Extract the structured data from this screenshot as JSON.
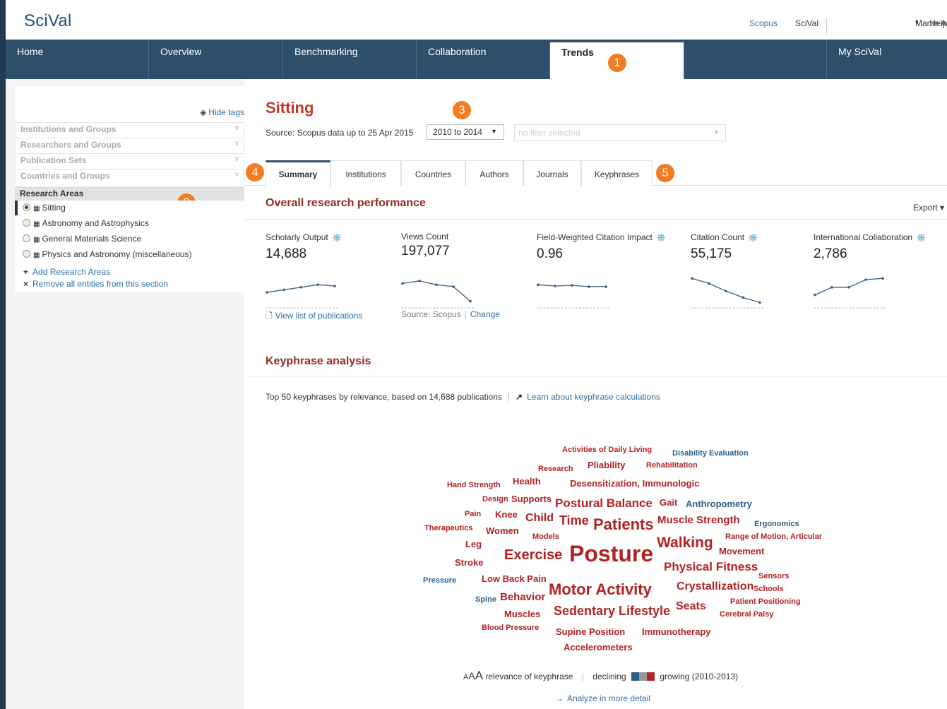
{
  "app": {
    "logo": "SciVal"
  },
  "toplinks": {
    "scopus": "Scopus",
    "scival": "SciVal",
    "user": "Martin Andersson",
    "user_caret": "▾",
    "help": "Help"
  },
  "nav": {
    "items": [
      "Home",
      "Overview",
      "Benchmarking",
      "Collaboration",
      "Trends",
      "",
      "My SciVal"
    ],
    "active": "Trends"
  },
  "badges": {
    "b1": "1",
    "b2": "2",
    "b3": "3",
    "b4": "4",
    "b5": "5"
  },
  "sidebar": {
    "hide_tags": "Hide tags",
    "sections": [
      "Institutions and Groups",
      "Researchers and Groups",
      "Publication Sets",
      "Countries and Groups"
    ],
    "research_areas_title": "Research Areas",
    "research_areas": [
      "Sitting",
      "Astronomy and Astrophysics",
      "General Materials Science",
      "Physics and Astronomy (miscellaneous)"
    ],
    "add_link": "Add Research Areas",
    "remove_link": "Remove all entities from this section"
  },
  "main": {
    "title": "Sitting",
    "source": "Source: Scopus data up to 25 Apr 2015",
    "year_range": "2010 to 2014",
    "filter_placeholder": "no filter selected",
    "tabs": [
      "Summary",
      "Institutions",
      "Countries",
      "Authors",
      "Journals",
      "Keyphrases"
    ],
    "active_tab": "Summary",
    "overall_title": "Overall research performance",
    "export": "Export",
    "metrics": [
      {
        "label": "Scholarly Output",
        "value": "14,688",
        "gear": true,
        "trend": [
          2,
          2.4,
          2.8,
          3.2,
          3
        ]
      },
      {
        "label": "Views Count",
        "value": "197,077",
        "gear": false,
        "trend": [
          3.4,
          3.8,
          3.2,
          2.9,
          0.6
        ]
      },
      {
        "label": "Field-Weighted Citation Impact",
        "value": "0.96",
        "gear": true,
        "trend": [
          3.2,
          3,
          3.1,
          2.9,
          2.9
        ]
      },
      {
        "label": "Citation Count",
        "value": "55,175",
        "gear": true,
        "trend": [
          4.2,
          3.4,
          2.2,
          1.2,
          0.4
        ]
      },
      {
        "label": "International Collaboration",
        "value": "2,786",
        "gear": true,
        "trend": [
          1.6,
          2.8,
          2.8,
          4,
          4.2
        ]
      }
    ],
    "view_list": "View list of publications",
    "source_scopus": "Source: Scopus",
    "change": "Change",
    "keyphrase_title": "Keyphrase analysis",
    "keyphrase_desc": "Top 50 keyphrases by relevance, based on 14,688 publications",
    "learn_link": "Learn about keyphrase calculations",
    "legend_text": "relevance of keyphrase",
    "legend_declining": "declining",
    "legend_growing": "growing",
    "legend_period": "(2010-2013)",
    "legend_aaa": [
      "A",
      "A",
      "A"
    ],
    "analyze": "Analyze in more detail"
  },
  "colors": {
    "growing": "#b22222",
    "declining": "#2a5f8a",
    "neutral": "#999999",
    "nav": "#2d4f6c",
    "badge": "#f47c20"
  },
  "keyphrases": [
    {
      "text": "Activities of Daily Living",
      "size": 11,
      "trend": "growing"
    },
    {
      "text": "Disability Evaluation",
      "size": 11,
      "trend": "declining"
    },
    {
      "text": "Research",
      "size": 11,
      "trend": "growing"
    },
    {
      "text": "Pliability",
      "size": 13,
      "trend": "growing"
    },
    {
      "text": "Rehabilitation",
      "size": 11,
      "trend": "growing"
    },
    {
      "text": "Hand Strength",
      "size": 11,
      "trend": "growing"
    },
    {
      "text": "Health",
      "size": 13,
      "trend": "growing"
    },
    {
      "text": "Desensitization, Immunologic",
      "size": 13,
      "trend": "growing"
    },
    {
      "text": "Design",
      "size": 11,
      "trend": "growing"
    },
    {
      "text": "Supports",
      "size": 13,
      "trend": "growing"
    },
    {
      "text": "Postural Balance",
      "size": 17,
      "trend": "growing"
    },
    {
      "text": "Gait",
      "size": 13,
      "trend": "growing"
    },
    {
      "text": "Anthropometry",
      "size": 13,
      "trend": "declining"
    },
    {
      "text": "Pain",
      "size": 11,
      "trend": "growing"
    },
    {
      "text": "Knee",
      "size": 13,
      "trend": "growing"
    },
    {
      "text": "Child",
      "size": 16,
      "trend": "growing"
    },
    {
      "text": "Time",
      "size": 18,
      "trend": "growing"
    },
    {
      "text": "Patients",
      "size": 22,
      "trend": "growing"
    },
    {
      "text": "Muscle Strength",
      "size": 15,
      "trend": "growing"
    },
    {
      "text": "Ergonomics",
      "size": 11,
      "trend": "declining"
    },
    {
      "text": "Therapeutics",
      "size": 11,
      "trend": "growing"
    },
    {
      "text": "Women",
      "size": 13,
      "trend": "growing"
    },
    {
      "text": "Models",
      "size": 11,
      "trend": "growing"
    },
    {
      "text": "Range of Motion, Articular",
      "size": 11,
      "trend": "growing"
    },
    {
      "text": "Leg",
      "size": 13,
      "trend": "growing"
    },
    {
      "text": "Walking",
      "size": 21,
      "trend": "growing"
    },
    {
      "text": "Movement",
      "size": 13,
      "trend": "growing"
    },
    {
      "text": "Exercise",
      "size": 20,
      "trend": "growing"
    },
    {
      "text": "Posture",
      "size": 32,
      "trend": "growing"
    },
    {
      "text": "Stroke",
      "size": 13,
      "trend": "growing"
    },
    {
      "text": "Physical Fitness",
      "size": 17,
      "trend": "growing"
    },
    {
      "text": "Sensors",
      "size": 11,
      "trend": "growing"
    },
    {
      "text": "Pressure",
      "size": 11,
      "trend": "declining"
    },
    {
      "text": "Low Back Pain",
      "size": 13,
      "trend": "growing"
    },
    {
      "text": "Motor Activity",
      "size": 22,
      "trend": "growing"
    },
    {
      "text": "Crystallization",
      "size": 16,
      "trend": "growing"
    },
    {
      "text": "Schools",
      "size": 11,
      "trend": "growing"
    },
    {
      "text": "Spine",
      "size": 11,
      "trend": "declining"
    },
    {
      "text": "Behavior",
      "size": 15,
      "trend": "growing"
    },
    {
      "text": "Patient Positioning",
      "size": 11,
      "trend": "growing"
    },
    {
      "text": "Muscles",
      "size": 13,
      "trend": "growing"
    },
    {
      "text": "Sedentary Lifestyle",
      "size": 18,
      "trend": "growing"
    },
    {
      "text": "Seats",
      "size": 16,
      "trend": "growing"
    },
    {
      "text": "Cerebral Palsy",
      "size": 11,
      "trend": "growing"
    },
    {
      "text": "Blood Pressure",
      "size": 11,
      "trend": "growing"
    },
    {
      "text": "Supine Position",
      "size": 13,
      "trend": "growing"
    },
    {
      "text": "Immunotherapy",
      "size": 13,
      "trend": "growing"
    },
    {
      "text": "Accelerometers",
      "size": 13,
      "trend": "growing"
    }
  ]
}
